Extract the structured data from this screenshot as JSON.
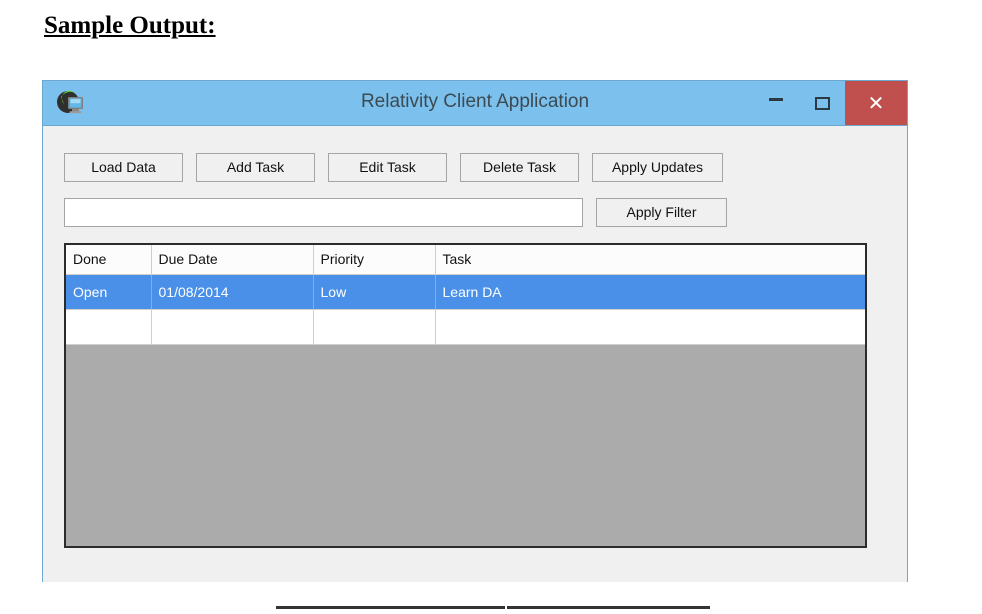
{
  "document": {
    "heading": "Sample Output:"
  },
  "window": {
    "title": "Relativity Client Application",
    "icon": "app-monitor-icon",
    "controls": {
      "minimize": "–",
      "maximize": "□",
      "close": "✕"
    },
    "colors": {
      "titlebar": "#7cc0ed",
      "close_button": "#c0504d",
      "body": "#f0f0f0",
      "grid_empty": "#ababab",
      "selection": "#4a90e8"
    }
  },
  "toolbar": {
    "buttons": [
      {
        "label": "Load Data"
      },
      {
        "label": "Add Task"
      },
      {
        "label": "Edit Task"
      },
      {
        "label": "Delete Task"
      },
      {
        "label": "Apply Updates"
      }
    ]
  },
  "filter": {
    "value": "",
    "placeholder": "",
    "apply_label": "Apply Filter"
  },
  "grid": {
    "columns": [
      {
        "key": "done",
        "label": "Done"
      },
      {
        "key": "due_date",
        "label": "Due Date"
      },
      {
        "key": "priority",
        "label": "Priority"
      },
      {
        "key": "task",
        "label": "Task"
      }
    ],
    "rows": [
      {
        "selected": true,
        "done": "Open",
        "due_date": "01/08/2014",
        "priority": "Low",
        "task": "Learn DA"
      },
      {
        "selected": false,
        "done": "",
        "due_date": "",
        "priority": "",
        "task": ""
      }
    ]
  }
}
